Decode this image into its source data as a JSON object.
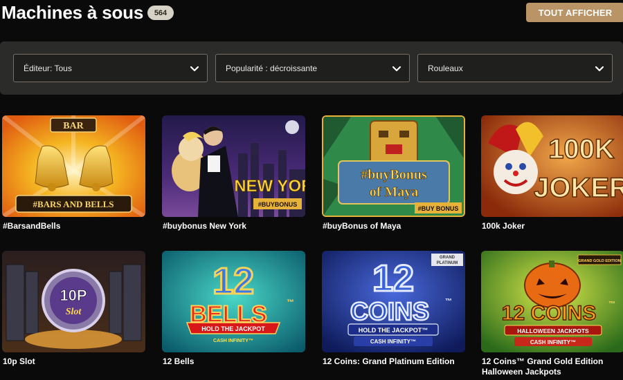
{
  "header": {
    "title": "Machines à sous",
    "count": "564",
    "show_all_label": "TOUT AFFICHER"
  },
  "filters": [
    {
      "label": "Éditeur: Tous"
    },
    {
      "label": "Popularité : décroissante"
    },
    {
      "label": "Rouleaux"
    }
  ],
  "games": [
    {
      "title": "#BarsandBells",
      "art": {
        "top": "BAR",
        "logo": "#BARS AND BELLS"
      }
    },
    {
      "title": "#buybonus New York",
      "art": {
        "line1": "NEW YORK",
        "badge": "#BUYBONUS"
      }
    },
    {
      "title": "#buyBonus of Maya",
      "art": {
        "line1": "#buyBonus",
        "line2": "of Maya",
        "badge": "#BUY BONUS"
      }
    },
    {
      "title": "100k Joker",
      "art": {
        "line1": "100K",
        "line2": "JOKER"
      }
    },
    {
      "title": "10p Slot",
      "art": {
        "line1": "10P",
        "line2": "Slot"
      }
    },
    {
      "title": "12 Bells",
      "art": {
        "num": "12",
        "word": "BELLS",
        "tm": "™",
        "banner": "HOLD THE JACKPOT",
        "sub": "CASH INFINITY™"
      }
    },
    {
      "title": "12 Coins: Grand Platinum Edition",
      "art": {
        "num": "12",
        "word": "COINS",
        "tm": "™",
        "corner1": "GRAND",
        "corner2": "PLATINUM",
        "banner": "HOLD THE JACKPOT™",
        "sub": "CASH INFINITY™"
      }
    },
    {
      "title": "12 Coins™ Grand Gold Edition Halloween Jackpots",
      "art": {
        "word": "12 COINS",
        "tm": "™",
        "corner": "GRAND GOLD EDITION",
        "banner": "HALLOWEEN JACKPOTS",
        "sub": "CASH INFINITY™"
      }
    }
  ],
  "icons": [
    "chevron-down-icon"
  ]
}
